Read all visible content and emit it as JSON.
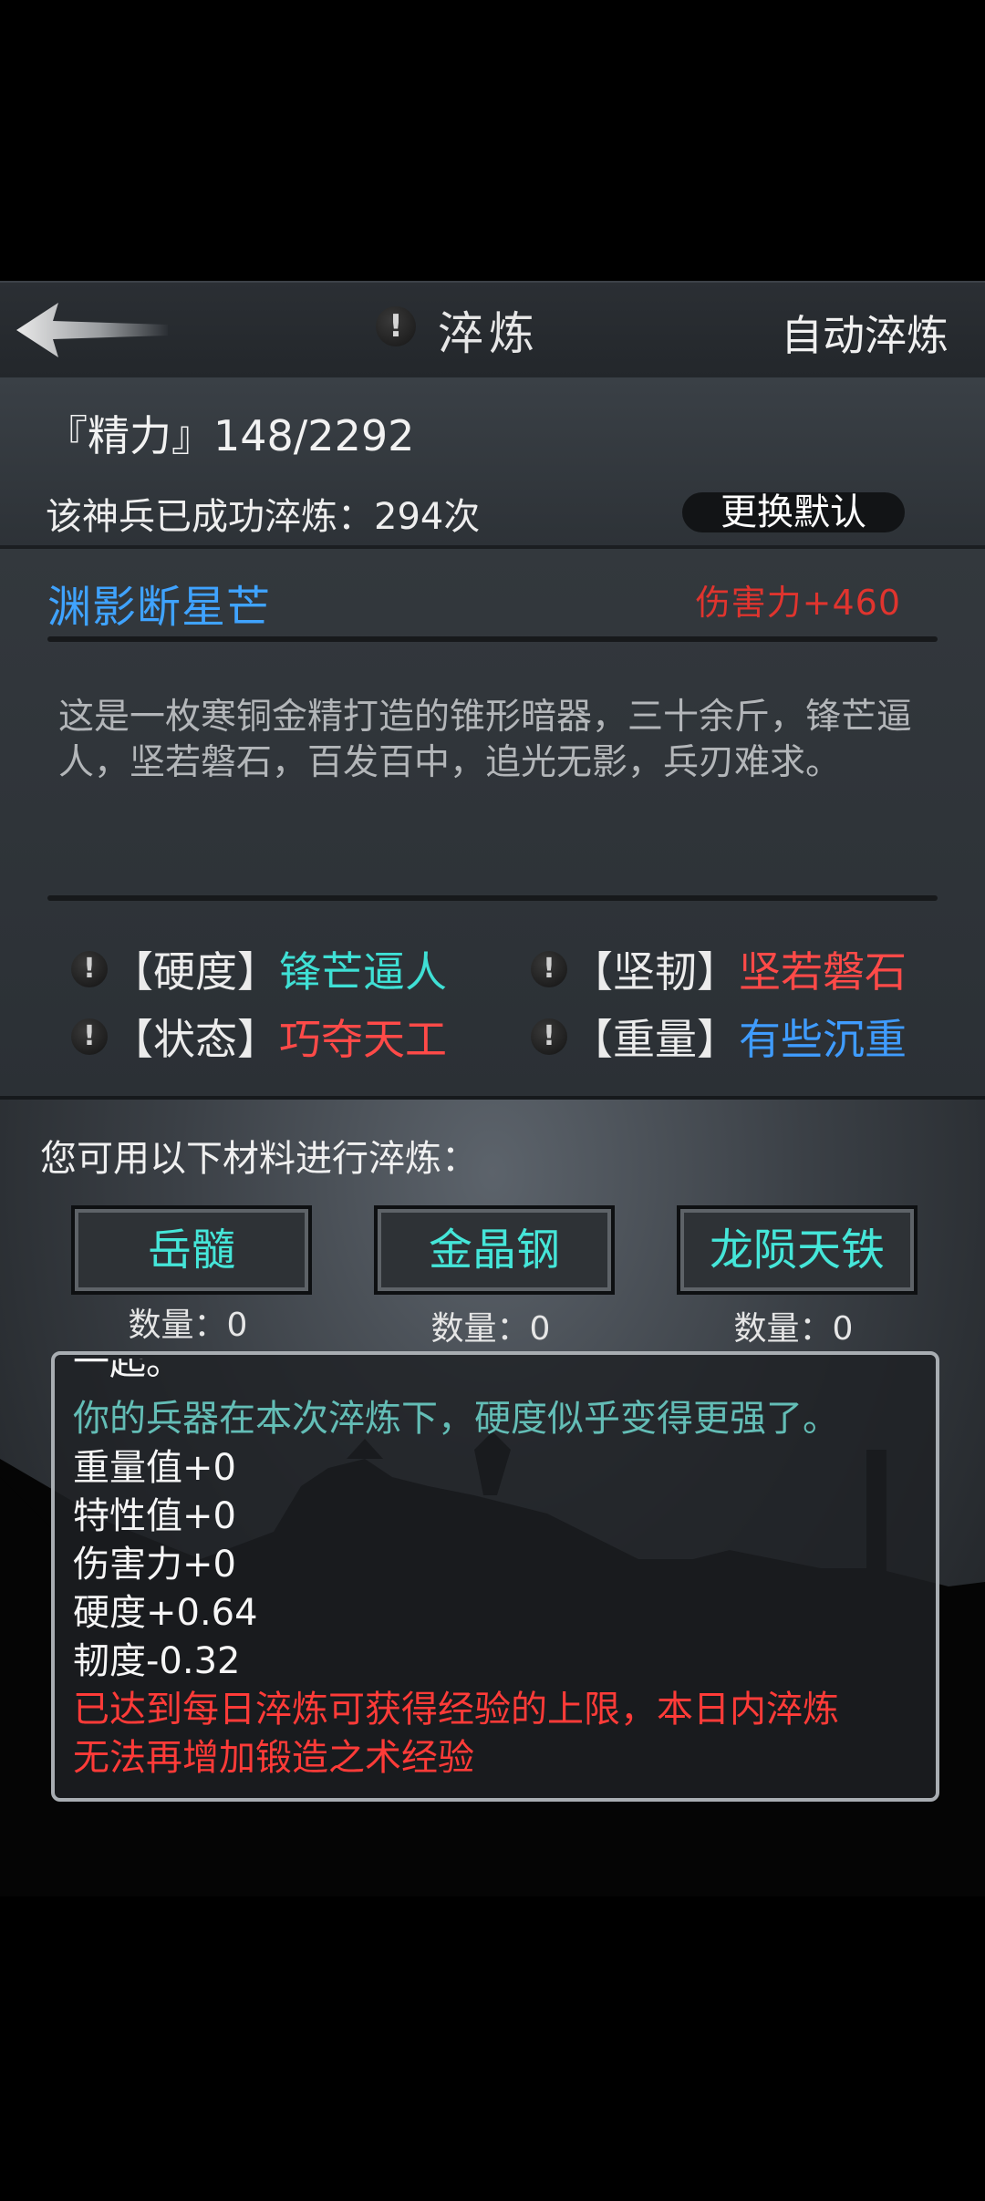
{
  "topbar": {
    "title": "淬炼",
    "info_icon": "!",
    "auto_label": "自动淬炼"
  },
  "stats": {
    "energy": "『精力』148/2292",
    "success_count": "该神兵已成功淬炼：294次",
    "change_default": "更换默认"
  },
  "weapon": {
    "name": "渊影断星芒",
    "damage": "伤害力+460",
    "description": "这是一枚寒铜金精打造的锥形暗器，三十余斤，锋芒逼人，坚若磐石，百发百中，追光无影，兵刃难求。",
    "attributes": [
      {
        "icon": "!",
        "label": "【硬度】",
        "value": "锋芒逼人",
        "color": "#3fe0d5"
      },
      {
        "icon": "!",
        "label": "【坚韧】",
        "value": "坚若磐石",
        "color": "#ff4a48"
      },
      {
        "icon": "!",
        "label": "【状态】",
        "value": "巧夺天工",
        "color": "#ff4a48"
      },
      {
        "icon": "!",
        "label": "【重量】",
        "value": "有些沉重",
        "color": "#3f9cff"
      }
    ]
  },
  "materials": {
    "prompt": "您可用以下材料进行淬炼：",
    "items": [
      {
        "name": "岳髓",
        "qty": "数量：0"
      },
      {
        "name": "金晶钢",
        "qty": "数量：0"
      },
      {
        "name": "龙陨天铁",
        "qty": "数量：0"
      }
    ]
  },
  "log": {
    "cut_line": "一起。",
    "lines": [
      "你的兵器在本次淬炼下，硬度似乎变得更强了。",
      "重量值+0",
      "特性值+0",
      "伤害力+0",
      "硬度+0.64",
      "韧度-0.32",
      "已达到每日淬炼可获得经验的上限，本日内淬炼",
      "无法再增加锻造之术经验"
    ]
  },
  "colors": {
    "accent_cyan": "#3fe0d5",
    "accent_red": "#ff4a48",
    "accent_blue": "#3f9cff"
  }
}
